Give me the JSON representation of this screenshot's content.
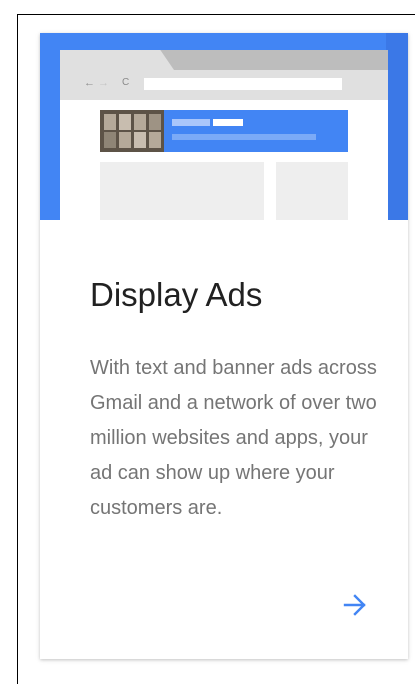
{
  "card": {
    "title": "Display Ads",
    "description": "With text and banner ads across Gmail and a network of over two million websites and apps, your ad can show up where your customers are."
  },
  "illustration": {
    "nav_back": "←",
    "nav_forward": "→",
    "nav_reload": "C"
  },
  "icons": {
    "arrow": "arrow-right-icon"
  },
  "colors": {
    "accent": "#4285f4",
    "hero_edge": "#3b78e7",
    "title": "#212121",
    "body_text": "#757575",
    "arrow": "#4285f4"
  }
}
